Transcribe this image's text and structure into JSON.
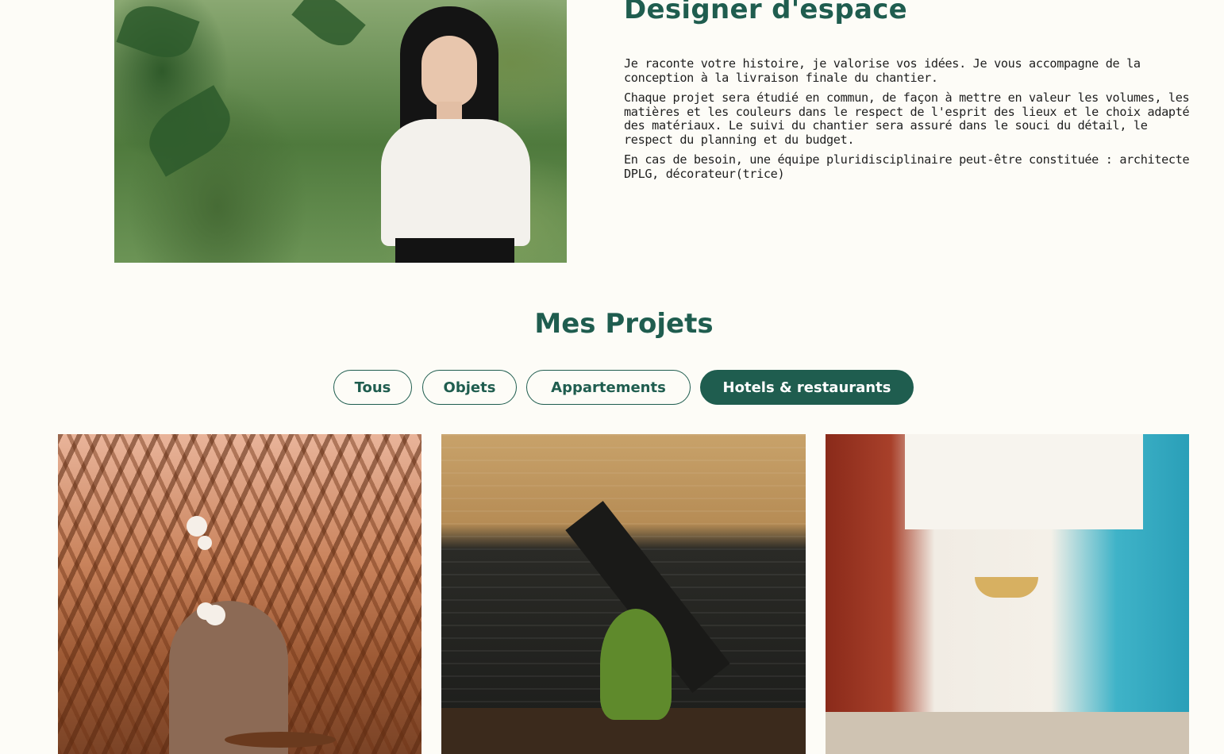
{
  "about": {
    "title": "Designer d'espace",
    "paragraphs": [
      "Je raconte votre histoire, je valorise vos idées. Je vous accompagne de la conception à la livraison finale du chantier.",
      "Chaque projet sera étudié en commun, de façon à mettre en valeur les volumes, les matières et les couleurs dans le respect de l'esprit des lieux et le choix adapté des matériaux. Le suivi du chantier sera assuré dans le souci du détail, le respect du planning et du budget.",
      "En cas de besoin, une équipe pluridisciplinaire peut-être constituée : architecte DPLG, décorateur(trice)"
    ]
  },
  "projects": {
    "title": "Mes Projets",
    "filters": [
      {
        "label": "Tous",
        "active": false
      },
      {
        "label": "Objets",
        "active": false
      },
      {
        "label": "Appartements",
        "active": false
      },
      {
        "label": "Hotels & restaurants",
        "active": true
      }
    ]
  },
  "colors": {
    "accent": "#1f5d4f",
    "background": "#fdfcf7"
  }
}
